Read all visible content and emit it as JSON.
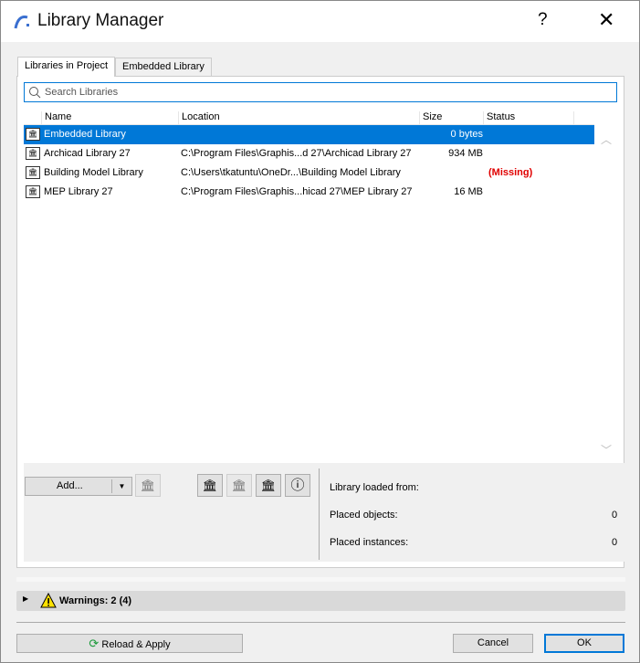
{
  "window": {
    "title": "Library Manager",
    "help": "?",
    "close": "✕"
  },
  "tabs": [
    {
      "label": "Libraries in Project"
    },
    {
      "label": "Embedded Library"
    }
  ],
  "search": {
    "placeholder": "Search Libraries"
  },
  "columns": [
    "Name",
    "Location",
    "Size",
    "Status"
  ],
  "rows": [
    {
      "name": "Embedded Library",
      "location": "",
      "size": "0 bytes",
      "status": ""
    },
    {
      "name": "Archicad Library 27",
      "location": "C:\\Program Files\\Graphis...d 27\\Archicad Library 27",
      "size": "934 MB",
      "status": ""
    },
    {
      "name": "Building Model Library",
      "location": "C:\\Users\\tkatuntu\\OneDr...\\Building Model Library",
      "size": "",
      "status": "(Missing)"
    },
    {
      "name": "MEP Library 27",
      "location": "C:\\Program Files\\Graphis...hicad 27\\MEP Library 27",
      "size": "16 MB",
      "status": ""
    }
  ],
  "buttons": {
    "add": "Add...",
    "reload": "Reload & Apply",
    "cancel": "Cancel",
    "ok": "OK"
  },
  "info": {
    "loaded_from": "Library loaded from:",
    "placed_objects": "Placed objects:",
    "placed_objects_value": "0",
    "placed_instances": "Placed instances:",
    "placed_instances_value": "0"
  },
  "warnings": {
    "label": "Warnings: 2 (4)"
  },
  "colors": {
    "accent": "#0078d7",
    "missing": "#e00000"
  }
}
